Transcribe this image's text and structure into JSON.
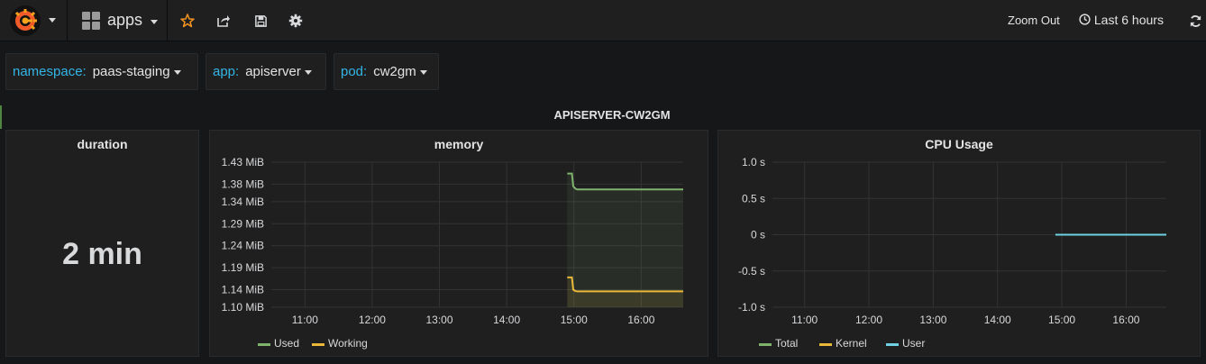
{
  "navbar": {
    "dashboard_name": "apps",
    "zoom_out_label": "Zoom Out",
    "time_range_label": "Last 6 hours",
    "colors": {
      "star": "#f79520",
      "bg": "#1f1f20"
    },
    "icons": [
      "grafana-logo-icon",
      "dashboard-grid-icon",
      "star-icon",
      "share-icon",
      "save-icon",
      "settings-icon",
      "clock-icon",
      "refresh-icon"
    ]
  },
  "variables": [
    {
      "label": "namespace:",
      "value": "paas-staging"
    },
    {
      "label": "app:",
      "value": "apiserver"
    },
    {
      "label": "pod:",
      "value": "cw2gm"
    }
  ],
  "row": {
    "title": "APISERVER-CW2GM"
  },
  "panels": {
    "duration": {
      "title": "duration",
      "value": "2 min"
    },
    "memory": {
      "title": "memory"
    },
    "cpu": {
      "title": "CPU Usage"
    }
  },
  "chart_data": [
    {
      "type": "area",
      "title": "memory",
      "x_ticks": [
        "11:00",
        "12:00",
        "13:00",
        "14:00",
        "15:00",
        "16:00"
      ],
      "y_ticks": [
        "1.43 MiB",
        "1.38 MiB",
        "1.34 MiB",
        "1.29 MiB",
        "1.24 MiB",
        "1.19 MiB",
        "1.14 MiB",
        "1.10 MiB"
      ],
      "ylim": [
        1.1,
        1.43
      ],
      "xlim": [
        10.5,
        16.625
      ],
      "grid": true,
      "legend_position": "bottom-left",
      "series": [
        {
          "name": "Used",
          "color": "#7eb26d",
          "x": [
            14.9,
            14.97,
            14.99,
            15.02,
            15.05,
            15.1,
            16.625
          ],
          "y": [
            1.404,
            1.404,
            1.375,
            1.37,
            1.368,
            1.368,
            1.368
          ]
        },
        {
          "name": "Working",
          "color": "#eab839",
          "x": [
            14.9,
            14.97,
            14.99,
            15.02,
            15.05,
            15.1,
            16.625
          ],
          "y": [
            1.168,
            1.168,
            1.14,
            1.137,
            1.136,
            1.136,
            1.136
          ]
        }
      ]
    },
    {
      "type": "line",
      "title": "CPU Usage",
      "x_ticks": [
        "11:00",
        "12:00",
        "13:00",
        "14:00",
        "15:00",
        "16:00"
      ],
      "y_ticks": [
        "1.0 s",
        "0.5 s",
        "0 s",
        "-0.5 s",
        "-1.0 s"
      ],
      "ylim": [
        -1.0,
        1.0
      ],
      "xlim": [
        10.5,
        16.625
      ],
      "grid": true,
      "legend_position": "bottom-left",
      "series": [
        {
          "name": "Total",
          "color": "#7eb26d",
          "x": [],
          "y": []
        },
        {
          "name": "Kernel",
          "color": "#eab839",
          "x": [],
          "y": []
        },
        {
          "name": "User",
          "color": "#6ed0e0",
          "x": [
            14.9,
            16.625
          ],
          "y": [
            0,
            0
          ]
        }
      ]
    }
  ]
}
